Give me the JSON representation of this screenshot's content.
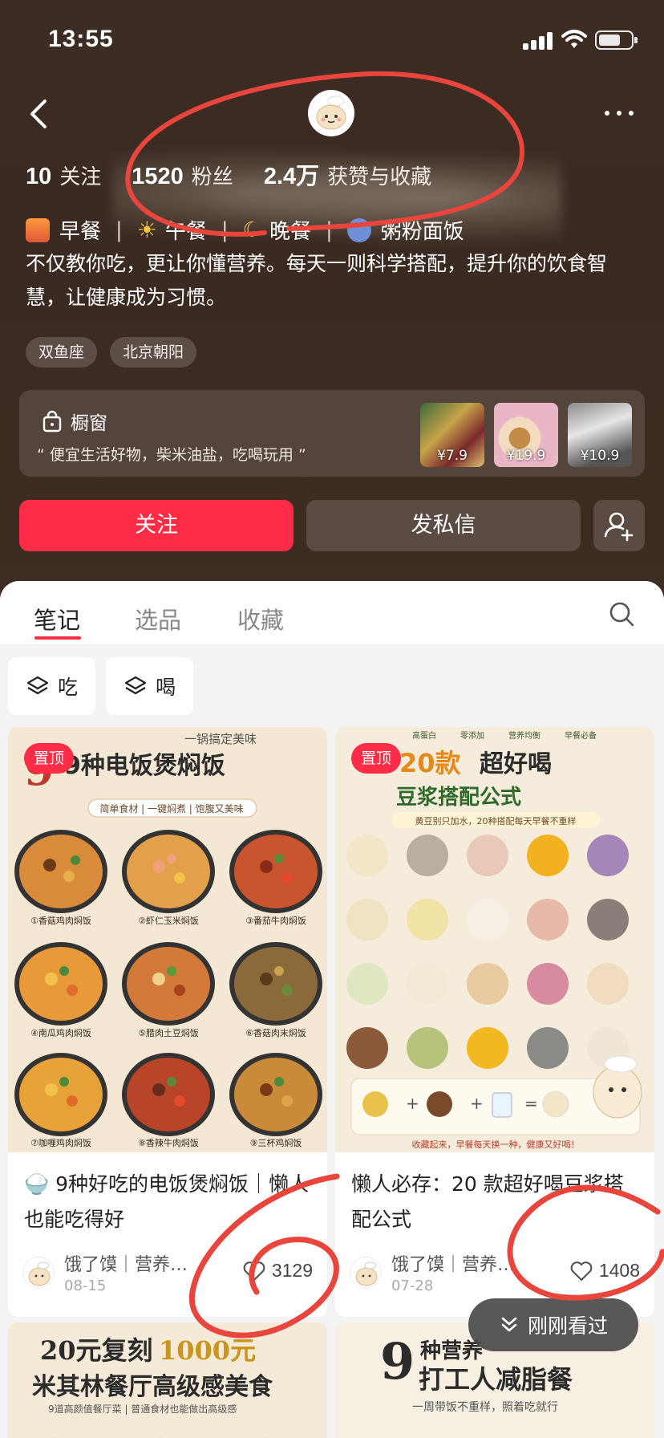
{
  "status_bar": {
    "time": "13:55"
  },
  "profile": {
    "stats": [
      {
        "num": "10",
        "label": "关注"
      },
      {
        "num": "1520",
        "label": "粉丝"
      },
      {
        "num": "2.4万",
        "label": "获赞与收藏"
      }
    ],
    "meals": [
      "早餐",
      "午餐",
      "晚餐",
      "粥粉面饭"
    ],
    "bio": "不仅教你吃，更让你懂营养。每天一则科学搭配，提升你的饮食智慧，让健康成为习惯。",
    "tags": [
      "双鱼座",
      "北京朝阳"
    ]
  },
  "shop": {
    "title": "橱窗",
    "subtitle": "“ 便宜生活好物，柴米油盐，吃喝玩用 ”",
    "items": [
      {
        "price": "¥7.9"
      },
      {
        "price": "¥19.9"
      },
      {
        "price": "¥10.9"
      }
    ]
  },
  "actions": {
    "follow": "关注",
    "message": "发私信"
  },
  "tabs": [
    "笔记",
    "选品",
    "收藏"
  ],
  "filters": [
    "吃",
    "喝"
  ],
  "notes": [
    {
      "badge": "置顶",
      "cover_title": "9种电饭煲焖饭",
      "cover_slogan": "一锅搞定美味",
      "cover_sub": "简单食材 | 一键焖煮 | 饱腹又美味",
      "dishes": [
        "①香菇鸡肉焖饭",
        "②虾仁玉米焖饭",
        "③番茄牛肉焖饭",
        "④南瓜鸡肉焖饭",
        "⑤腊肉土豆焖饭",
        "⑥香菇肉末焖饭",
        "⑦咖喱鸡肉焖饭",
        "⑧香辣牛肉焖饭",
        "⑨三杯鸡焖饭"
      ],
      "title": "🍚 9种好吃的电饭煲焖饭｜懒人也能吃得好",
      "author": "饿了馍｜营养…",
      "date": "08-15",
      "likes": "3129"
    },
    {
      "badge": "置顶",
      "cover_title_a": "20款",
      "cover_title_b": "超好喝",
      "cover_title_c": "豆浆搭配公式",
      "cover_tags": [
        "高蛋白",
        "零添加",
        "营养均衡",
        "早餐必备"
      ],
      "cover_sub": "黄豆别只加水，20种搭配每天早餐不重样",
      "cover_footer": "收藏起来，早餐每天换一种，健康又好喝！",
      "title": "懒人必存：20 款超好喝豆浆搭配公式",
      "author": "饿了馍｜营养…",
      "date": "07-28",
      "likes": "1408"
    }
  ],
  "notes_row2": [
    {
      "line1a": "20元复刻",
      "line1b": "1000元",
      "line2": "米其林餐厅高级感美食",
      "line3": "9道高颜值餐厅菜 | 普通食材也能做出高级感"
    },
    {
      "line1a": "9",
      "line1b": "种营养",
      "line2": "打工人减脂餐",
      "line3": "一周带饭不重样，照着吃就行"
    }
  ],
  "recent_button": "刚刚看过",
  "colors": {
    "accent": "#fe2c45",
    "header_bg": "#3d2c24",
    "annotation": "#e8453c"
  }
}
